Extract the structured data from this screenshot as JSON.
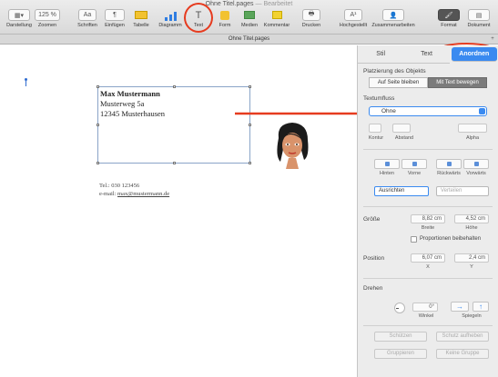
{
  "window": {
    "title": "Ohne Titel.pages",
    "subtitle": "— Bearbeitet"
  },
  "toolbar": {
    "items": [
      {
        "label": "Darstellung",
        "icon": "sidebar-icon"
      },
      {
        "label": "Zoomen",
        "icon": "zoom-popup",
        "value": "125 %"
      },
      {
        "label": "Schriften",
        "icon": "fonts-icon",
        "value": "Aa"
      },
      {
        "label": "Einfügen",
        "icon": "insert-icon",
        "value": "¶"
      },
      {
        "label": "Tabelle",
        "icon": "table-icon"
      },
      {
        "label": "Diagramm",
        "icon": "chart-icon"
      },
      {
        "label": "Text",
        "icon": "text-icon",
        "value": "T"
      },
      {
        "label": "Form",
        "icon": "shape-icon"
      },
      {
        "label": "Medien",
        "icon": "media-icon"
      },
      {
        "label": "Kommentar",
        "icon": "comment-icon"
      },
      {
        "label": "Drucken",
        "icon": "print-icon"
      },
      {
        "label": "Hochgestellt",
        "icon": "superscript-icon",
        "value": "A¹"
      },
      {
        "label": "Zusammenarbeiten",
        "icon": "collaborate-icon"
      },
      {
        "label": "Format",
        "icon": "format-icon"
      },
      {
        "label": "Dokument",
        "icon": "document-icon"
      }
    ]
  },
  "tabbar": {
    "title": "Ohne Titel.pages",
    "add": "+"
  },
  "document": {
    "address": {
      "name": "Max Mustermann",
      "street": "Musterweg 5a",
      "city": "12345 Musterhausen"
    },
    "contact": {
      "phone": "Tel.: 030 123456",
      "email_label": "e-mail:",
      "email": "max@mustermann.de"
    }
  },
  "inspector": {
    "tabs": [
      "Stil",
      "Text",
      "Anordnen"
    ],
    "active_tab": "Anordnen",
    "placement": {
      "label": "Platzierung des Objekts",
      "options": [
        "Auf Seite bleiben",
        "Mit Text bewegen"
      ],
      "selected": "Mit Text bewegen"
    },
    "text_wrap": {
      "label": "Textumfluss",
      "value": "Ohne",
      "sub_labels": [
        "Kontur",
        "Abstand",
        "Alpha"
      ]
    },
    "order": {
      "labels": [
        "Hinten",
        "Vorne",
        "Rückwärts",
        "Vorwärts"
      ]
    },
    "align": {
      "value": "Ausrichten",
      "distribute": "Verteilen"
    },
    "size": {
      "label": "Größe",
      "width": "8,82 cm",
      "width_label": "Breite",
      "height": "4,52 cm",
      "height_label": "Höhe",
      "keep_proportions": "Proportionen beibehalten"
    },
    "position": {
      "label": "Position",
      "x": "6,07 cm",
      "x_label": "X",
      "y": "2,4 cm",
      "y_label": "Y"
    },
    "rotate": {
      "label": "Drehen",
      "angle": "0°",
      "angle_label": "Winkel",
      "flip_label": "Spiegeln"
    },
    "buttons": [
      "Schützen",
      "Schutz aufheben",
      "Gruppieren",
      "Keine Gruppe"
    ]
  },
  "colors": {
    "accent": "#3a8af0",
    "annotation": "#e63b1f"
  }
}
